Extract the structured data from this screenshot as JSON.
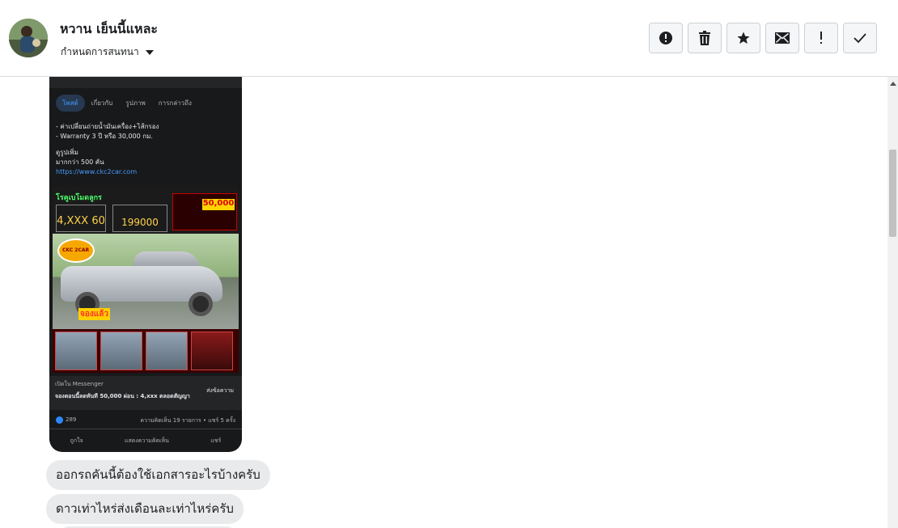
{
  "header": {
    "contact_name": "หวาน เย็นนี้แหละ",
    "assign_label": "กำหนดการสนทนา",
    "avatar_icon": "avatar",
    "actions": [
      {
        "name": "report-spam-button",
        "icon": "exclamation-circle-icon"
      },
      {
        "name": "delete-button",
        "icon": "trash-icon"
      },
      {
        "name": "star-button",
        "icon": "star-icon"
      },
      {
        "name": "mark-unread-button",
        "icon": "envelope-icon"
      },
      {
        "name": "follow-up-button",
        "icon": "exclamation-icon"
      },
      {
        "name": "mark-done-button",
        "icon": "checkmark-icon"
      }
    ]
  },
  "thread": {
    "shared_post": {
      "tabs": [
        "โพสต์",
        "เกี่ยวกับ",
        "รูปภาพ",
        "การกล่าวถึง"
      ],
      "text_lines": [
        "- ค่าเปลี่ยนถ่ายน้ำมันเครื่อง+ไส้กรอง",
        "- Warranty 3 ปี หรือ 30,000 กม.",
        "ดูรูปเพิ่ม",
        "มากกว่า 500 คัน"
      ],
      "link": "https://www.ckc2car.com",
      "ad_headline": "โรคูเบโมดลูกร",
      "ad_down_payment": "4,XXX 60",
      "ad_price": "199000",
      "ad_promo_amount": "50,000",
      "ad_logo": "CKC 2CAR",
      "ad_sold_tag": "จองแล้ว",
      "ad_source": "เปิดใน Messenger",
      "ad_title": "จองตอนนี้ลดทันที 50,000 ผ่อน : 4,xxx ตลอดสัญญา",
      "ad_send_label": "ส่งข้อความ",
      "like_count": "289",
      "react_meta": "ความคิดเห็น 19 รายการ • แชร์ 5 ครั้ง",
      "like_label": "ถูกใจ",
      "comment_label": "แสดงความคิดเห็น",
      "share_label": "แชร์"
    },
    "messages": [
      {
        "text": "ออกรถคันนี้ต้องใช้เอกสารอะไรบ้างครับ"
      },
      {
        "text": "ดาวเท่าไหร่ส่งเดือนละเท่าไหร่ครับ"
      }
    ]
  },
  "colors": {
    "bubble": "#e9eaeb",
    "border": "#dadde1",
    "link": "#4599ff"
  }
}
